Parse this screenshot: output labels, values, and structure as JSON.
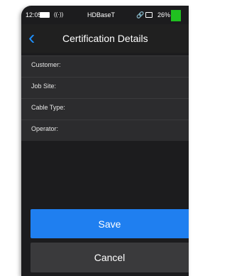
{
  "status": {
    "time": "12:05",
    "connection": "HDBaseT",
    "battery": "26%",
    "icons": [
      "battery-icon",
      "wifi-icon",
      "link-icon",
      "monitor-icon",
      "battery-level-icon"
    ]
  },
  "header": {
    "back_icon": "chevron-left-icon",
    "title": "Certification Details"
  },
  "fields": [
    {
      "label": "Customer:"
    },
    {
      "label": "Job Site:"
    },
    {
      "label": "Cable Type:"
    },
    {
      "label": "Operator:"
    }
  ],
  "actions": {
    "save_label": "Save",
    "cancel_label": "Cancel"
  },
  "colors": {
    "accent": "#1f7ff0",
    "background": "#1c1c1e",
    "battery": "#20c020"
  }
}
